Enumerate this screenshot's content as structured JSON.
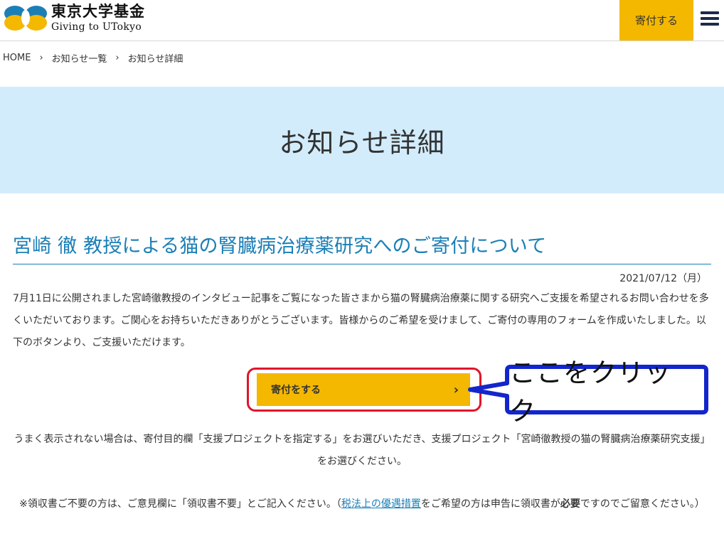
{
  "header": {
    "logo_jp": "東京大学基金",
    "logo_en": "Giving to UTokyo",
    "donate_label": "寄付する",
    "colors": {
      "brand_yellow": "#f4b800",
      "brand_blue": "#1b7fb6"
    }
  },
  "breadcrumb": {
    "home": "HOME",
    "list": "お知らせ一覧",
    "current": "お知らせ詳細"
  },
  "banner": {
    "title": "お知らせ詳細"
  },
  "article": {
    "title": "宮崎 徹 教授による猫の腎臓病治療薬研究へのご寄付について",
    "date": "2021/07/12（月）",
    "body": "7月11日に公開されました宮崎徹教授のインタビュー記事をご覧になった皆さまから猫の腎臓病治療薬に関する研究へご支援を希望されるお問い合わせを多くいただいております。ご関心をお持ちいただきありがとうございます。皆様からのご希望を受けまして、ご寄付の専用のフォームを作成いたしました。以下のボタンより、ご支援いただけます。",
    "donate_button": "寄付をする",
    "callout": "ここをクリック",
    "note1": "うまく表示されない場合は、寄付目的欄「支援プロジェクトを指定する」をお選びいただき、支援プロジェクト「宮崎徹教授の猫の腎臓病治療薬研究支援」をお選びください。",
    "note2_prefix": "※領収書ご不要の方は、ご意見欄に「領収書不要」とご記入ください。（",
    "note2_link": "税法上の優遇措置",
    "note2_mid": "をご希望の方は申告に領収書が",
    "note2_bold": "必要",
    "note2_suffix": "ですのでご留意ください。）"
  }
}
